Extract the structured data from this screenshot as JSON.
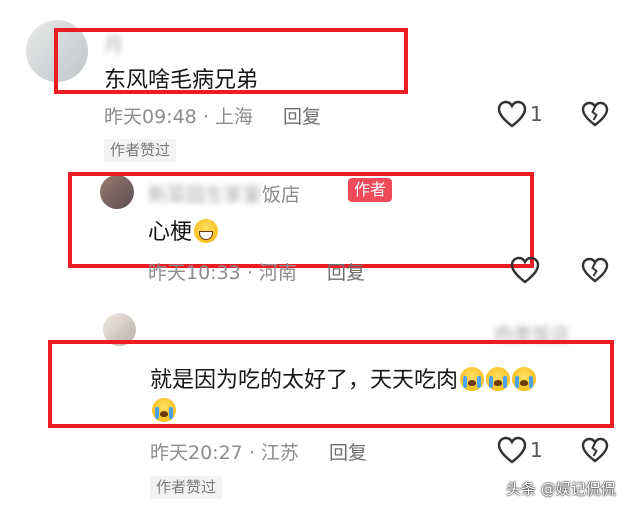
{
  "comments": [
    {
      "name": "月",
      "content": "东风啥毛病兄弟",
      "time": "昨天09:48",
      "location": "上海",
      "reply": "回复",
      "likes": "1",
      "liked_badge": "作者赞过"
    },
    {
      "name": "新菜园生家宴",
      "name_suffix": "饭店",
      "author_tag": "作者",
      "content": "心梗",
      "time": "昨天10:33",
      "location": "河南",
      "reply": "回复"
    },
    {
      "name": "肉类饭店",
      "content": "就是因为吃的太好了，天天吃肉",
      "time": "昨天20:27",
      "location": "江苏",
      "reply": "回复",
      "likes": "1",
      "liked_badge": "作者赞过"
    }
  ],
  "separator": "·",
  "watermark": "头条 @娱记侃侃",
  "icons": [
    "heart-icon",
    "dislike-heart-icon",
    "grin-emoji-icon",
    "crying-emoji-icon"
  ],
  "colors": {
    "highlight_border": "#ec1c24",
    "author_tag": "#f04a5b",
    "meta_text": "#8d8d8d"
  }
}
